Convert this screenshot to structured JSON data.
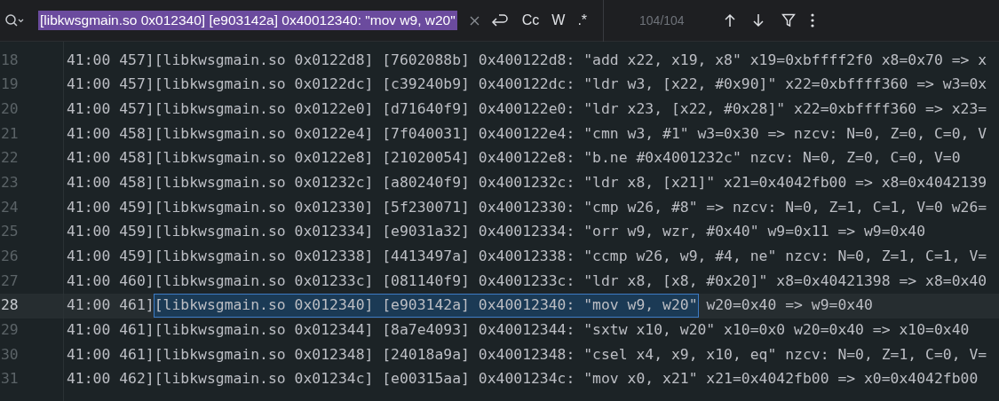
{
  "search": {
    "value": "[libkwsgmain.so 0x012340] [e903142a] 0x40012340: \"mov w9, w20\"",
    "selected": true,
    "toggles": [
      {
        "label": "Cc",
        "on": false
      },
      {
        "label": "W",
        "on": false
      },
      {
        "label": ".*",
        "on": false
      }
    ],
    "count": "104/104"
  },
  "lines": [
    {
      "number": "18",
      "current": false,
      "segments": [
        {
          "text": "41:00 457][libkwsgmain.so 0x0122d8] [7602088b] 0x400122d8: \"add x22, x19, x8\" x19=0xbffff2f0 x8=0x70 => x",
          "match": false
        }
      ]
    },
    {
      "number": "19",
      "current": false,
      "segments": [
        {
          "text": "41:00 457][libkwsgmain.so 0x0122dc] [c39240b9] 0x400122dc: \"ldr w3, [x22, #0x90]\" x22=0xbffff360 => w3=0x",
          "match": false
        }
      ]
    },
    {
      "number": "20",
      "current": false,
      "segments": [
        {
          "text": "41:00 457][libkwsgmain.so 0x0122e0] [d71640f9] 0x400122e0: \"ldr x23, [x22, #0x28]\" x22=0xbffff360 => x23=",
          "match": false
        }
      ]
    },
    {
      "number": "21",
      "current": false,
      "segments": [
        {
          "text": "41:00 458][libkwsgmain.so 0x0122e4] [7f040031] 0x400122e4: \"cmn w3, #1\" w3=0x30 => nzcv: N=0, Z=0, C=0, V",
          "match": false
        }
      ]
    },
    {
      "number": "22",
      "current": false,
      "segments": [
        {
          "text": "41:00 458][libkwsgmain.so 0x0122e8] [21020054] 0x400122e8: \"b.ne #0x4001232c\" nzcv: N=0, Z=0, C=0, V=0",
          "match": false
        }
      ]
    },
    {
      "number": "23",
      "current": false,
      "segments": [
        {
          "text": "41:00 458][libkwsgmain.so 0x01232c] [a80240f9] 0x4001232c: \"ldr x8, [x21]\" x21=0x4042fb00 => x8=0x4042139",
          "match": false
        }
      ]
    },
    {
      "number": "24",
      "current": false,
      "segments": [
        {
          "text": "41:00 459][libkwsgmain.so 0x012330] [5f230071] 0x40012330: \"cmp w26, #8\" => nzcv: N=0, Z=1, C=1, V=0 w26=",
          "match": false
        }
      ]
    },
    {
      "number": "25",
      "current": false,
      "segments": [
        {
          "text": "41:00 459][libkwsgmain.so 0x012334] [e9031a32] 0x40012334: \"orr w9, wzr, #0x40\" w9=0x11 => w9=0x40",
          "match": false
        }
      ]
    },
    {
      "number": "26",
      "current": false,
      "segments": [
        {
          "text": "41:00 459][libkwsgmain.so 0x012338] [4413497a] 0x40012338: \"ccmp w26, w9, #4, ne\" nzcv: N=0, Z=1, C=1, V=",
          "match": false
        }
      ]
    },
    {
      "number": "27",
      "current": false,
      "segments": [
        {
          "text": "41:00 460][libkwsgmain.so 0x01233c] [081140f9] 0x4001233c: \"ldr x8, [x8, #0x20]\" x8=0x40421398 => x8=0x40",
          "match": false
        }
      ]
    },
    {
      "number": "28",
      "current": true,
      "segments": [
        {
          "text": "41:00 461]",
          "match": false
        },
        {
          "text": "[libkwsgmain.so 0x012340] [e903142a] 0x40012340: \"mov w9, w20\"",
          "match": true
        },
        {
          "text": " w20=0x40 => w9=0x40",
          "match": false
        }
      ]
    },
    {
      "number": "29",
      "current": false,
      "segments": [
        {
          "text": "41:00 461][libkwsgmain.so 0x012344] [8a7e4093] 0x40012344: \"sxtw x10, w20\" x10=0x0 w20=0x40 => x10=0x40",
          "match": false
        }
      ]
    },
    {
      "number": "30",
      "current": false,
      "segments": [
        {
          "text": "41:00 461][libkwsgmain.so 0x012348] [24018a9a] 0x40012348: \"csel x4, x9, x10, eq\" nzcv: N=0, Z=1, C=0, V=",
          "match": false
        }
      ]
    },
    {
      "number": "31",
      "current": false,
      "segments": [
        {
          "text": "41:00 462][libkwsgmain.so 0x01234c] [e00315aa] 0x4001234c: \"mov x0, x21\" x21=0x4042fb00 => x0=0x4042fb00",
          "match": false
        }
      ]
    }
  ]
}
